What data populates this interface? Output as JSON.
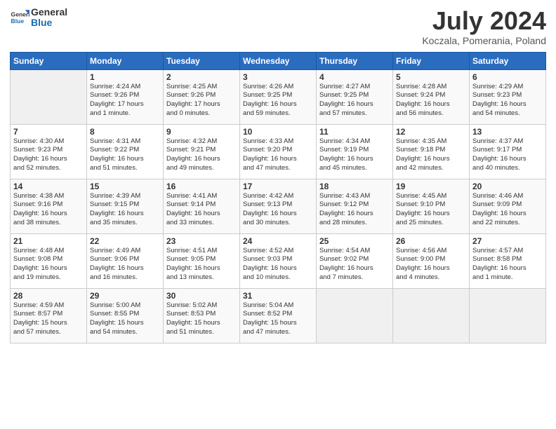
{
  "header": {
    "logo_line1": "General",
    "logo_line2": "Blue",
    "month_title": "July 2024",
    "location": "Koczala, Pomerania, Poland"
  },
  "weekdays": [
    "Sunday",
    "Monday",
    "Tuesday",
    "Wednesday",
    "Thursday",
    "Friday",
    "Saturday"
  ],
  "weeks": [
    [
      {
        "day": "",
        "info": ""
      },
      {
        "day": "1",
        "info": "Sunrise: 4:24 AM\nSunset: 9:26 PM\nDaylight: 17 hours\nand 1 minute."
      },
      {
        "day": "2",
        "info": "Sunrise: 4:25 AM\nSunset: 9:26 PM\nDaylight: 17 hours\nand 0 minutes."
      },
      {
        "day": "3",
        "info": "Sunrise: 4:26 AM\nSunset: 9:25 PM\nDaylight: 16 hours\nand 59 minutes."
      },
      {
        "day": "4",
        "info": "Sunrise: 4:27 AM\nSunset: 9:25 PM\nDaylight: 16 hours\nand 57 minutes."
      },
      {
        "day": "5",
        "info": "Sunrise: 4:28 AM\nSunset: 9:24 PM\nDaylight: 16 hours\nand 56 minutes."
      },
      {
        "day": "6",
        "info": "Sunrise: 4:29 AM\nSunset: 9:23 PM\nDaylight: 16 hours\nand 54 minutes."
      }
    ],
    [
      {
        "day": "7",
        "info": "Sunrise: 4:30 AM\nSunset: 9:23 PM\nDaylight: 16 hours\nand 52 minutes."
      },
      {
        "day": "8",
        "info": "Sunrise: 4:31 AM\nSunset: 9:22 PM\nDaylight: 16 hours\nand 51 minutes."
      },
      {
        "day": "9",
        "info": "Sunrise: 4:32 AM\nSunset: 9:21 PM\nDaylight: 16 hours\nand 49 minutes."
      },
      {
        "day": "10",
        "info": "Sunrise: 4:33 AM\nSunset: 9:20 PM\nDaylight: 16 hours\nand 47 minutes."
      },
      {
        "day": "11",
        "info": "Sunrise: 4:34 AM\nSunset: 9:19 PM\nDaylight: 16 hours\nand 45 minutes."
      },
      {
        "day": "12",
        "info": "Sunrise: 4:35 AM\nSunset: 9:18 PM\nDaylight: 16 hours\nand 42 minutes."
      },
      {
        "day": "13",
        "info": "Sunrise: 4:37 AM\nSunset: 9:17 PM\nDaylight: 16 hours\nand 40 minutes."
      }
    ],
    [
      {
        "day": "14",
        "info": "Sunrise: 4:38 AM\nSunset: 9:16 PM\nDaylight: 16 hours\nand 38 minutes."
      },
      {
        "day": "15",
        "info": "Sunrise: 4:39 AM\nSunset: 9:15 PM\nDaylight: 16 hours\nand 35 minutes."
      },
      {
        "day": "16",
        "info": "Sunrise: 4:41 AM\nSunset: 9:14 PM\nDaylight: 16 hours\nand 33 minutes."
      },
      {
        "day": "17",
        "info": "Sunrise: 4:42 AM\nSunset: 9:13 PM\nDaylight: 16 hours\nand 30 minutes."
      },
      {
        "day": "18",
        "info": "Sunrise: 4:43 AM\nSunset: 9:12 PM\nDaylight: 16 hours\nand 28 minutes."
      },
      {
        "day": "19",
        "info": "Sunrise: 4:45 AM\nSunset: 9:10 PM\nDaylight: 16 hours\nand 25 minutes."
      },
      {
        "day": "20",
        "info": "Sunrise: 4:46 AM\nSunset: 9:09 PM\nDaylight: 16 hours\nand 22 minutes."
      }
    ],
    [
      {
        "day": "21",
        "info": "Sunrise: 4:48 AM\nSunset: 9:08 PM\nDaylight: 16 hours\nand 19 minutes."
      },
      {
        "day": "22",
        "info": "Sunrise: 4:49 AM\nSunset: 9:06 PM\nDaylight: 16 hours\nand 16 minutes."
      },
      {
        "day": "23",
        "info": "Sunrise: 4:51 AM\nSunset: 9:05 PM\nDaylight: 16 hours\nand 13 minutes."
      },
      {
        "day": "24",
        "info": "Sunrise: 4:52 AM\nSunset: 9:03 PM\nDaylight: 16 hours\nand 10 minutes."
      },
      {
        "day": "25",
        "info": "Sunrise: 4:54 AM\nSunset: 9:02 PM\nDaylight: 16 hours\nand 7 minutes."
      },
      {
        "day": "26",
        "info": "Sunrise: 4:56 AM\nSunset: 9:00 PM\nDaylight: 16 hours\nand 4 minutes."
      },
      {
        "day": "27",
        "info": "Sunrise: 4:57 AM\nSunset: 8:58 PM\nDaylight: 16 hours\nand 1 minute."
      }
    ],
    [
      {
        "day": "28",
        "info": "Sunrise: 4:59 AM\nSunset: 8:57 PM\nDaylight: 15 hours\nand 57 minutes."
      },
      {
        "day": "29",
        "info": "Sunrise: 5:00 AM\nSunset: 8:55 PM\nDaylight: 15 hours\nand 54 minutes."
      },
      {
        "day": "30",
        "info": "Sunrise: 5:02 AM\nSunset: 8:53 PM\nDaylight: 15 hours\nand 51 minutes."
      },
      {
        "day": "31",
        "info": "Sunrise: 5:04 AM\nSunset: 8:52 PM\nDaylight: 15 hours\nand 47 minutes."
      },
      {
        "day": "",
        "info": ""
      },
      {
        "day": "",
        "info": ""
      },
      {
        "day": "",
        "info": ""
      }
    ]
  ]
}
